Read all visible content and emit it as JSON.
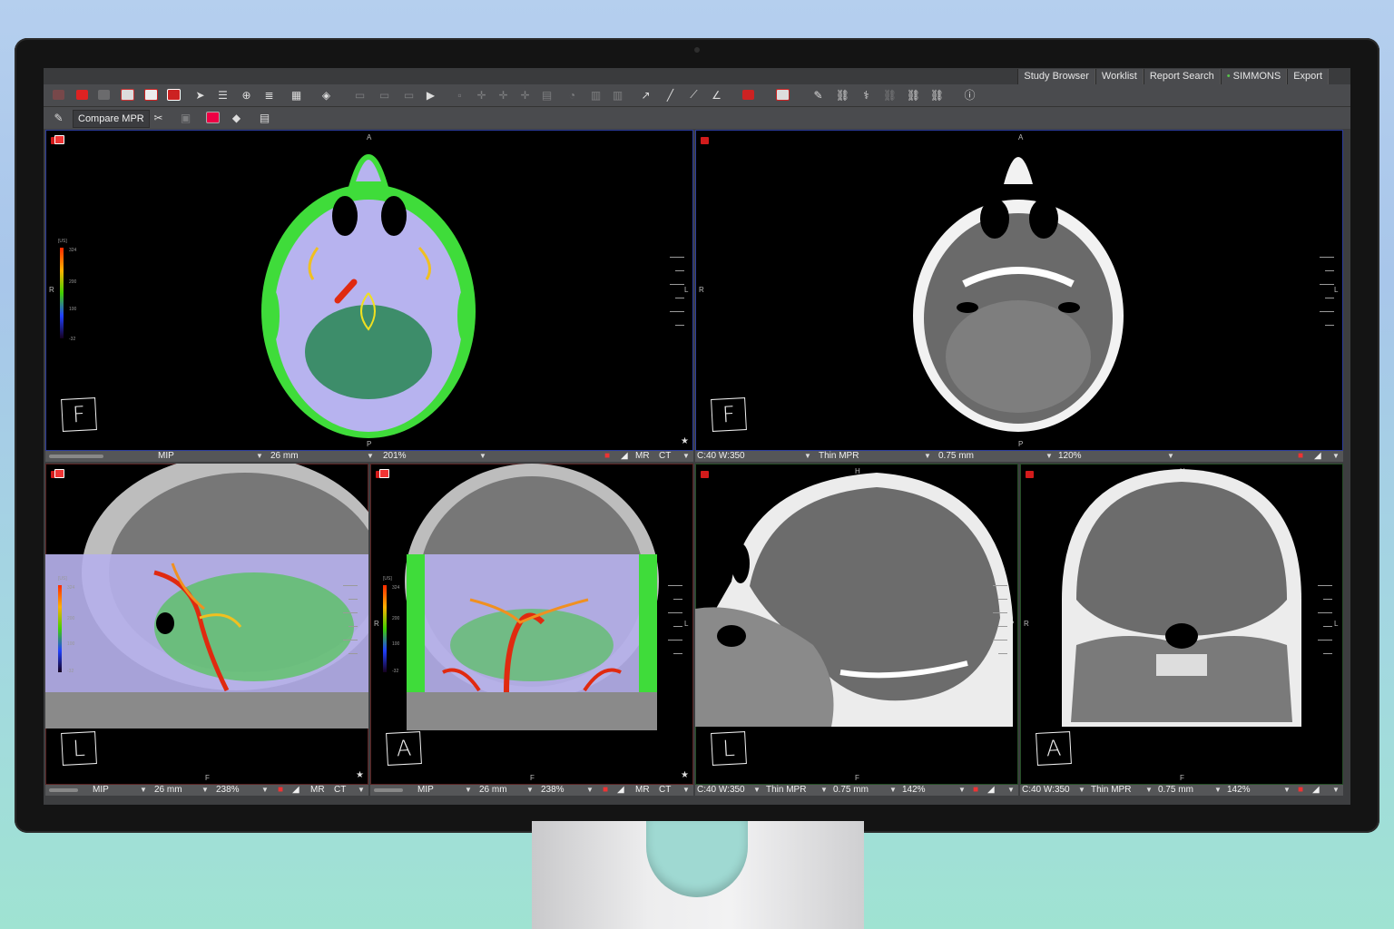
{
  "menu": {
    "tabs": [
      {
        "label": "Study Browser"
      },
      {
        "label": "Worklist"
      },
      {
        "label": "Report Search"
      },
      {
        "label": "SIMMONS"
      },
      {
        "label": "Export"
      }
    ]
  },
  "toolbar2": {
    "compare_label": "Compare MPR"
  },
  "viewports": {
    "top_left": {
      "render_mode": "MIP",
      "thickness": "26 mm",
      "zoom": "201%",
      "modality1": "MR",
      "modality2": "CT",
      "orient_top": "A",
      "orient_bottom": "P",
      "orient_left": "R",
      "orient_right": "L",
      "letter": "F",
      "colorbar": {
        "unit": "[US]",
        "t1": "324",
        "t2": "200",
        "t3": "100",
        "t4": "-32"
      }
    },
    "top_right": {
      "window": "C:40 W:350",
      "render_mode": "Thin MPR",
      "thickness": "0.75 mm",
      "zoom": "120%",
      "orient_top": "A",
      "orient_bottom": "P",
      "orient_left": "R",
      "orient_right": "L",
      "letter": "F"
    },
    "bottom_1": {
      "render_mode": "MIP",
      "thickness": "26 mm",
      "zoom": "238%",
      "modality1": "MR",
      "modality2": "CT",
      "orient_top": "H",
      "orient_bottom": "F",
      "orient_right": "P",
      "letter": "L",
      "colorbar": {
        "unit": "[US]",
        "t1": "324",
        "t2": "200",
        "t3": "100",
        "t4": "-32"
      }
    },
    "bottom_2": {
      "render_mode": "MIP",
      "thickness": "26 mm",
      "zoom": "238%",
      "modality1": "MR",
      "modality2": "CT",
      "orient_top": "H",
      "orient_bottom": "F",
      "orient_left": "R",
      "orient_right": "L",
      "letter": "A",
      "colorbar": {
        "unit": "[US]",
        "t1": "324",
        "t2": "200",
        "t3": "100",
        "t4": "-32"
      }
    },
    "bottom_3": {
      "window": "C:40 W:350",
      "render_mode": "Thin MPR",
      "thickness": "0.75 mm",
      "zoom": "142%",
      "orient_top": "H",
      "orient_bottom": "F",
      "orient_right": "P",
      "letter": "L"
    },
    "bottom_4": {
      "window": "C:40 W:350",
      "render_mode": "Thin MPR",
      "thickness": "0.75 mm",
      "zoom": "142%",
      "orient_top": "H",
      "orient_bottom": "F",
      "orient_left": "R",
      "orient_right": "L",
      "letter": "A"
    }
  },
  "colors": {
    "accent_green": "#58c34a",
    "viewport_blue": "#2c3c9e",
    "fusion_green": "#3fdc3a",
    "fusion_lavender": "#b8b4f0",
    "vessel_red": "#e02a10"
  }
}
